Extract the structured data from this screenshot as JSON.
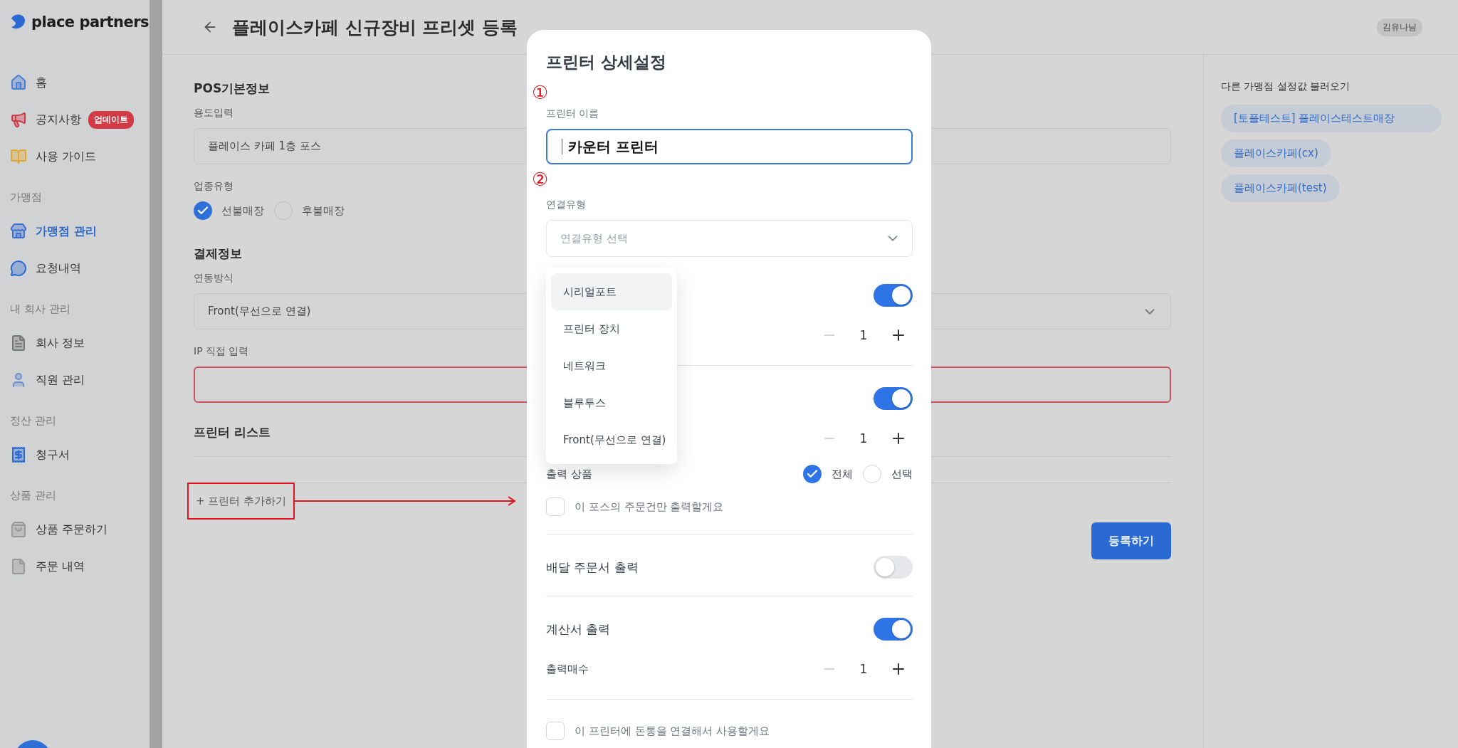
{
  "sidebar": {
    "logo": "place partners",
    "sections": [
      {
        "items": [
          {
            "label": "홈",
            "selected": false
          },
          {
            "label": "공지사항",
            "badge": "업데이트",
            "selected": false
          },
          {
            "label": "사용 가이드",
            "selected": false
          }
        ]
      },
      {
        "title": "가맹점",
        "items": [
          {
            "label": "가맹점 관리",
            "selected": true
          },
          {
            "label": "요청내역",
            "selected": false
          }
        ]
      },
      {
        "title": "내 회사 관리",
        "items": [
          {
            "label": "회사 정보",
            "selected": false
          },
          {
            "label": "직원 관리",
            "selected": false
          }
        ]
      },
      {
        "title": "정산 관리",
        "items": [
          {
            "label": "청구서",
            "selected": false
          }
        ]
      },
      {
        "title": "상품 관리",
        "items": [
          {
            "label": "상품 주문하기",
            "selected": false
          },
          {
            "label": "주문 내역",
            "selected": false
          }
        ]
      }
    ]
  },
  "header": {
    "title": "플레이스카페 신규장비 프리셋 등록",
    "user": "김유나님"
  },
  "pos_info": {
    "title": "POS기본정보",
    "purpose": {
      "label": "용도입력",
      "value": "플레이스 카페 1층 포스"
    },
    "business_type": {
      "label": "업종유형",
      "options": [
        {
          "label": "선불매장",
          "selected": true
        },
        {
          "label": "후불매장",
          "selected": false
        }
      ]
    }
  },
  "payment": {
    "title": "결제정보",
    "method": {
      "label": "연동방식",
      "value": "Front(무선으로 연결)"
    },
    "ip": {
      "label": "IP 직접 입력",
      "invalid": true
    }
  },
  "printer_list": {
    "title": "프린터 리스트",
    "add_button": "+ 프린터 추가하기",
    "highlighted": true
  },
  "submit_button": "등록하기",
  "right_panel": {
    "title": "다른 가맹점 설정값 불러오기",
    "stores": [
      "[토플테스트] 플레이스테스트매장",
      "플레이스카페(cx)",
      "플레이스카페(test)"
    ]
  },
  "modal": {
    "title": "프린터 상세설정",
    "name": {
      "marker": "①",
      "label": "프린터 이름",
      "value": "카운터 프린터",
      "focused": true
    },
    "connection": {
      "marker": "②",
      "label": "연결유형",
      "placeholder": "연결유형 선택",
      "expanded": true,
      "options": [
        {
          "label": "시리얼포트",
          "selected": true
        },
        {
          "label": "프린터 장치",
          "selected": false
        },
        {
          "label": "네트워크",
          "selected": false
        },
        {
          "label": "블루투스",
          "selected": false
        },
        {
          "label": "Front(무선으로 연결)",
          "selected": false
        }
      ]
    },
    "groups": [
      [
        {
          "kind": "toggle",
          "on": true
        },
        {
          "kind": "counter",
          "value": "1"
        }
      ],
      [
        {
          "kind": "toggle",
          "on": true
        },
        {
          "kind": "counter",
          "value": "1"
        },
        {
          "kind": "radio",
          "label": "출력 상품",
          "options": [
            {
              "label": "전체",
              "selected": true
            },
            {
              "label": "선택",
              "selected": false
            }
          ]
        },
        {
          "kind": "checkbox",
          "label": "이 포스의 주문건만 출력할게요",
          "checked": false
        }
      ],
      [
        {
          "kind": "toggle",
          "label": "배달 주문서 출력",
          "on": false
        }
      ],
      [
        {
          "kind": "toggle",
          "label": "계산서 출력",
          "on": true
        },
        {
          "kind": "counter",
          "label": "출력매수",
          "value": "1"
        }
      ],
      [
        {
          "kind": "checkbox",
          "label": "이 프린터에 돈통을 연결해서 사용할게요",
          "checked": false
        }
      ]
    ]
  }
}
